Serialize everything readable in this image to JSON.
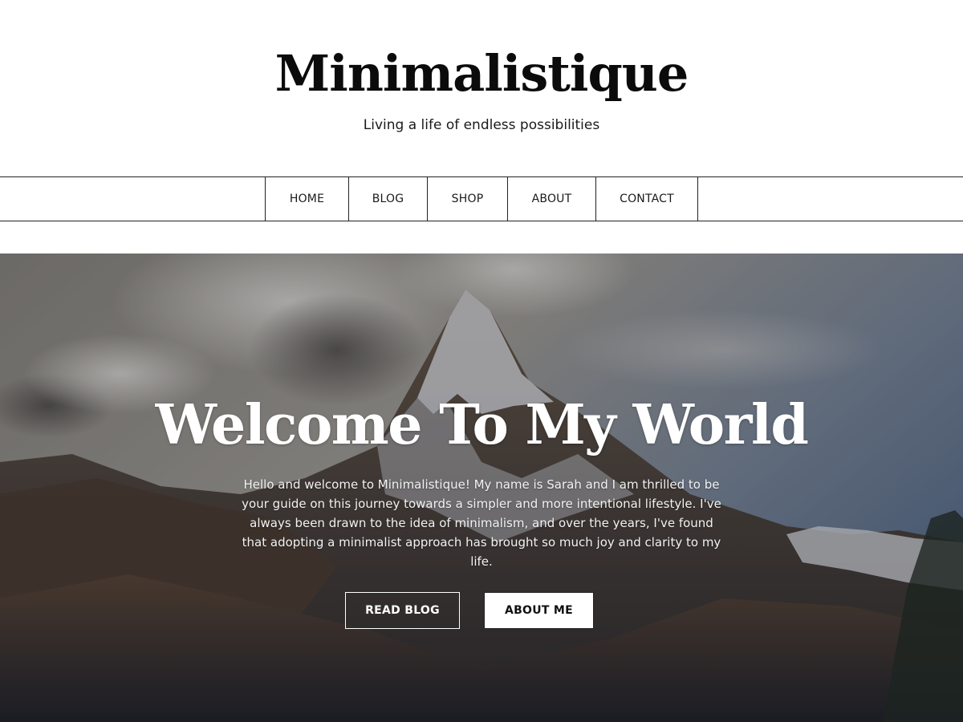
{
  "site": {
    "title": "Minimalistique",
    "tagline": "Living a life of endless possibilities"
  },
  "nav": {
    "items": [
      {
        "label": "HOME"
      },
      {
        "label": "BLOG"
      },
      {
        "label": "SHOP"
      },
      {
        "label": "ABOUT"
      },
      {
        "label": "CONTACT"
      }
    ]
  },
  "hero": {
    "title": "Welcome To My World",
    "text": "Hello and welcome to Minimalistique! My name is Sarah and I am thrilled to be your guide on this journey towards a simpler and more intentional lifestyle. I've always been drawn to the idea of minimalism, and over the years, I've found that adopting a minimalist approach has brought so much joy and clarity to my life.",
    "buttons": {
      "read_blog": "READ BLOG",
      "about_me": "ABOUT ME"
    }
  },
  "colors": {
    "text": "#111111",
    "border": "#222222",
    "hero_text": "#ffffff"
  }
}
